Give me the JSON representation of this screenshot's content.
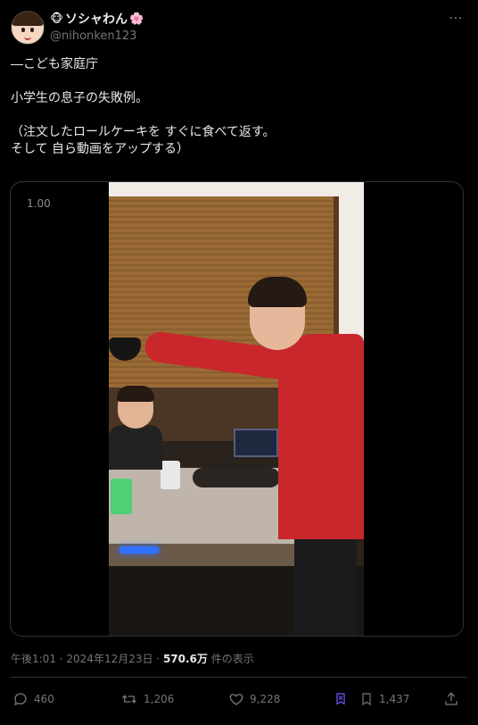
{
  "author": {
    "display_name": "ソシャわん",
    "name_emoji_left": "🐵",
    "name_emoji_right": "🌸",
    "handle": "@nihonken123"
  },
  "more_label": "⋯",
  "tweet": {
    "lines": [
      "⎯⎯こども家庭庁",
      "",
      "小学生の息子の失敗例。",
      "",
      "（注文したロールケーキを すぐに食べて返す。",
      "そして 自ら動画をアップする）"
    ]
  },
  "video": {
    "speed_label": "1.00"
  },
  "meta": {
    "time": "午後1:01",
    "sep1": " · ",
    "date": "2024年12月23日",
    "sep2": " · ",
    "views_count": "570.6万",
    "views_label": " 件の表示"
  },
  "actions": {
    "reply_count": "460",
    "retweet_count": "1,206",
    "like_count": "9,228",
    "bookmark_count": "1,437"
  },
  "colors": {
    "background": "#000000",
    "text": "#e7e9ea",
    "muted": "#71767b",
    "accent_grok": "#7856ff"
  }
}
